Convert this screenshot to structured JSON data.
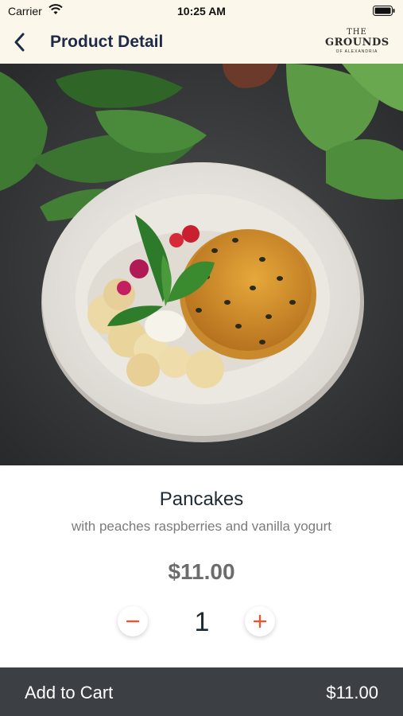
{
  "status_bar": {
    "carrier": "Carrier",
    "time": "10:25 AM",
    "wifi_icon": "wifi-icon",
    "battery_icon": "battery-icon"
  },
  "nav": {
    "title": "Product Detail",
    "back_icon": "chevron-left-icon",
    "logo": {
      "line1": "THE",
      "line2": "GROUNDS",
      "line3": "OF ALEXANDRIA"
    }
  },
  "product": {
    "image_icon": "pancakes-photo",
    "name": "Pancakes",
    "description": "with peaches raspberries and vanilla yogurt",
    "price": "$11.00",
    "quantity": "1",
    "decrement_icon": "minus-icon",
    "increment_icon": "plus-icon"
  },
  "cart": {
    "label": "Add to Cart",
    "total": "$11.00"
  },
  "colors": {
    "header_bg": "#fbf7ea",
    "title": "#1e2a48",
    "accent": "#e05a3a",
    "cart_bar": "#3c4044"
  }
}
